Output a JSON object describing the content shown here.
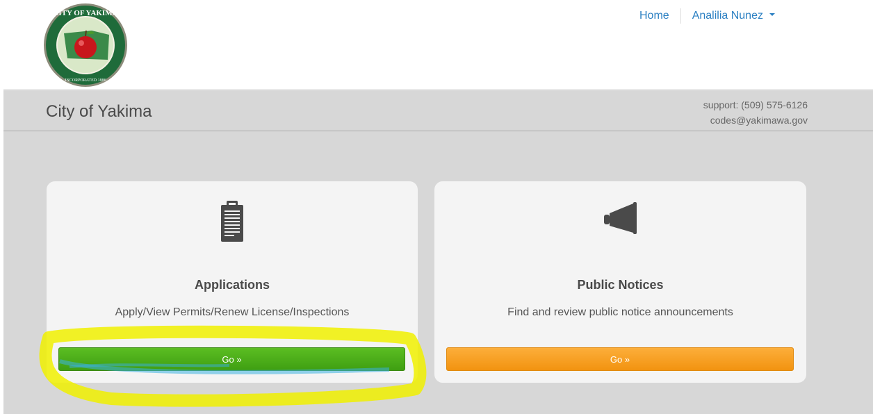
{
  "header": {
    "seal_text_top": "CITY OF YAKIMA",
    "seal_text_bottom": "INCORPORATED 1886",
    "nav": {
      "home": "Home",
      "user": "Analilia Nunez"
    }
  },
  "banner": {
    "title": "City of Yakima",
    "support_phone": "support: (509) 575-6126",
    "support_email": "codes@yakimawa.gov"
  },
  "cards": [
    {
      "icon": "clipboard-icon",
      "title": "Applications",
      "description": "Apply/View Permits/Renew License/Inspections",
      "button": "Go »",
      "button_color": "#4aab18"
    },
    {
      "icon": "megaphone-icon",
      "title": "Public Notices",
      "description": "Find and review public notice announcements",
      "button": "Go »",
      "button_color": "#f7a023"
    }
  ],
  "colors": {
    "link": "#2a7fc2",
    "background": "#d7d7d7",
    "card": "#f4f4f4",
    "highlight": "#f0f000"
  }
}
